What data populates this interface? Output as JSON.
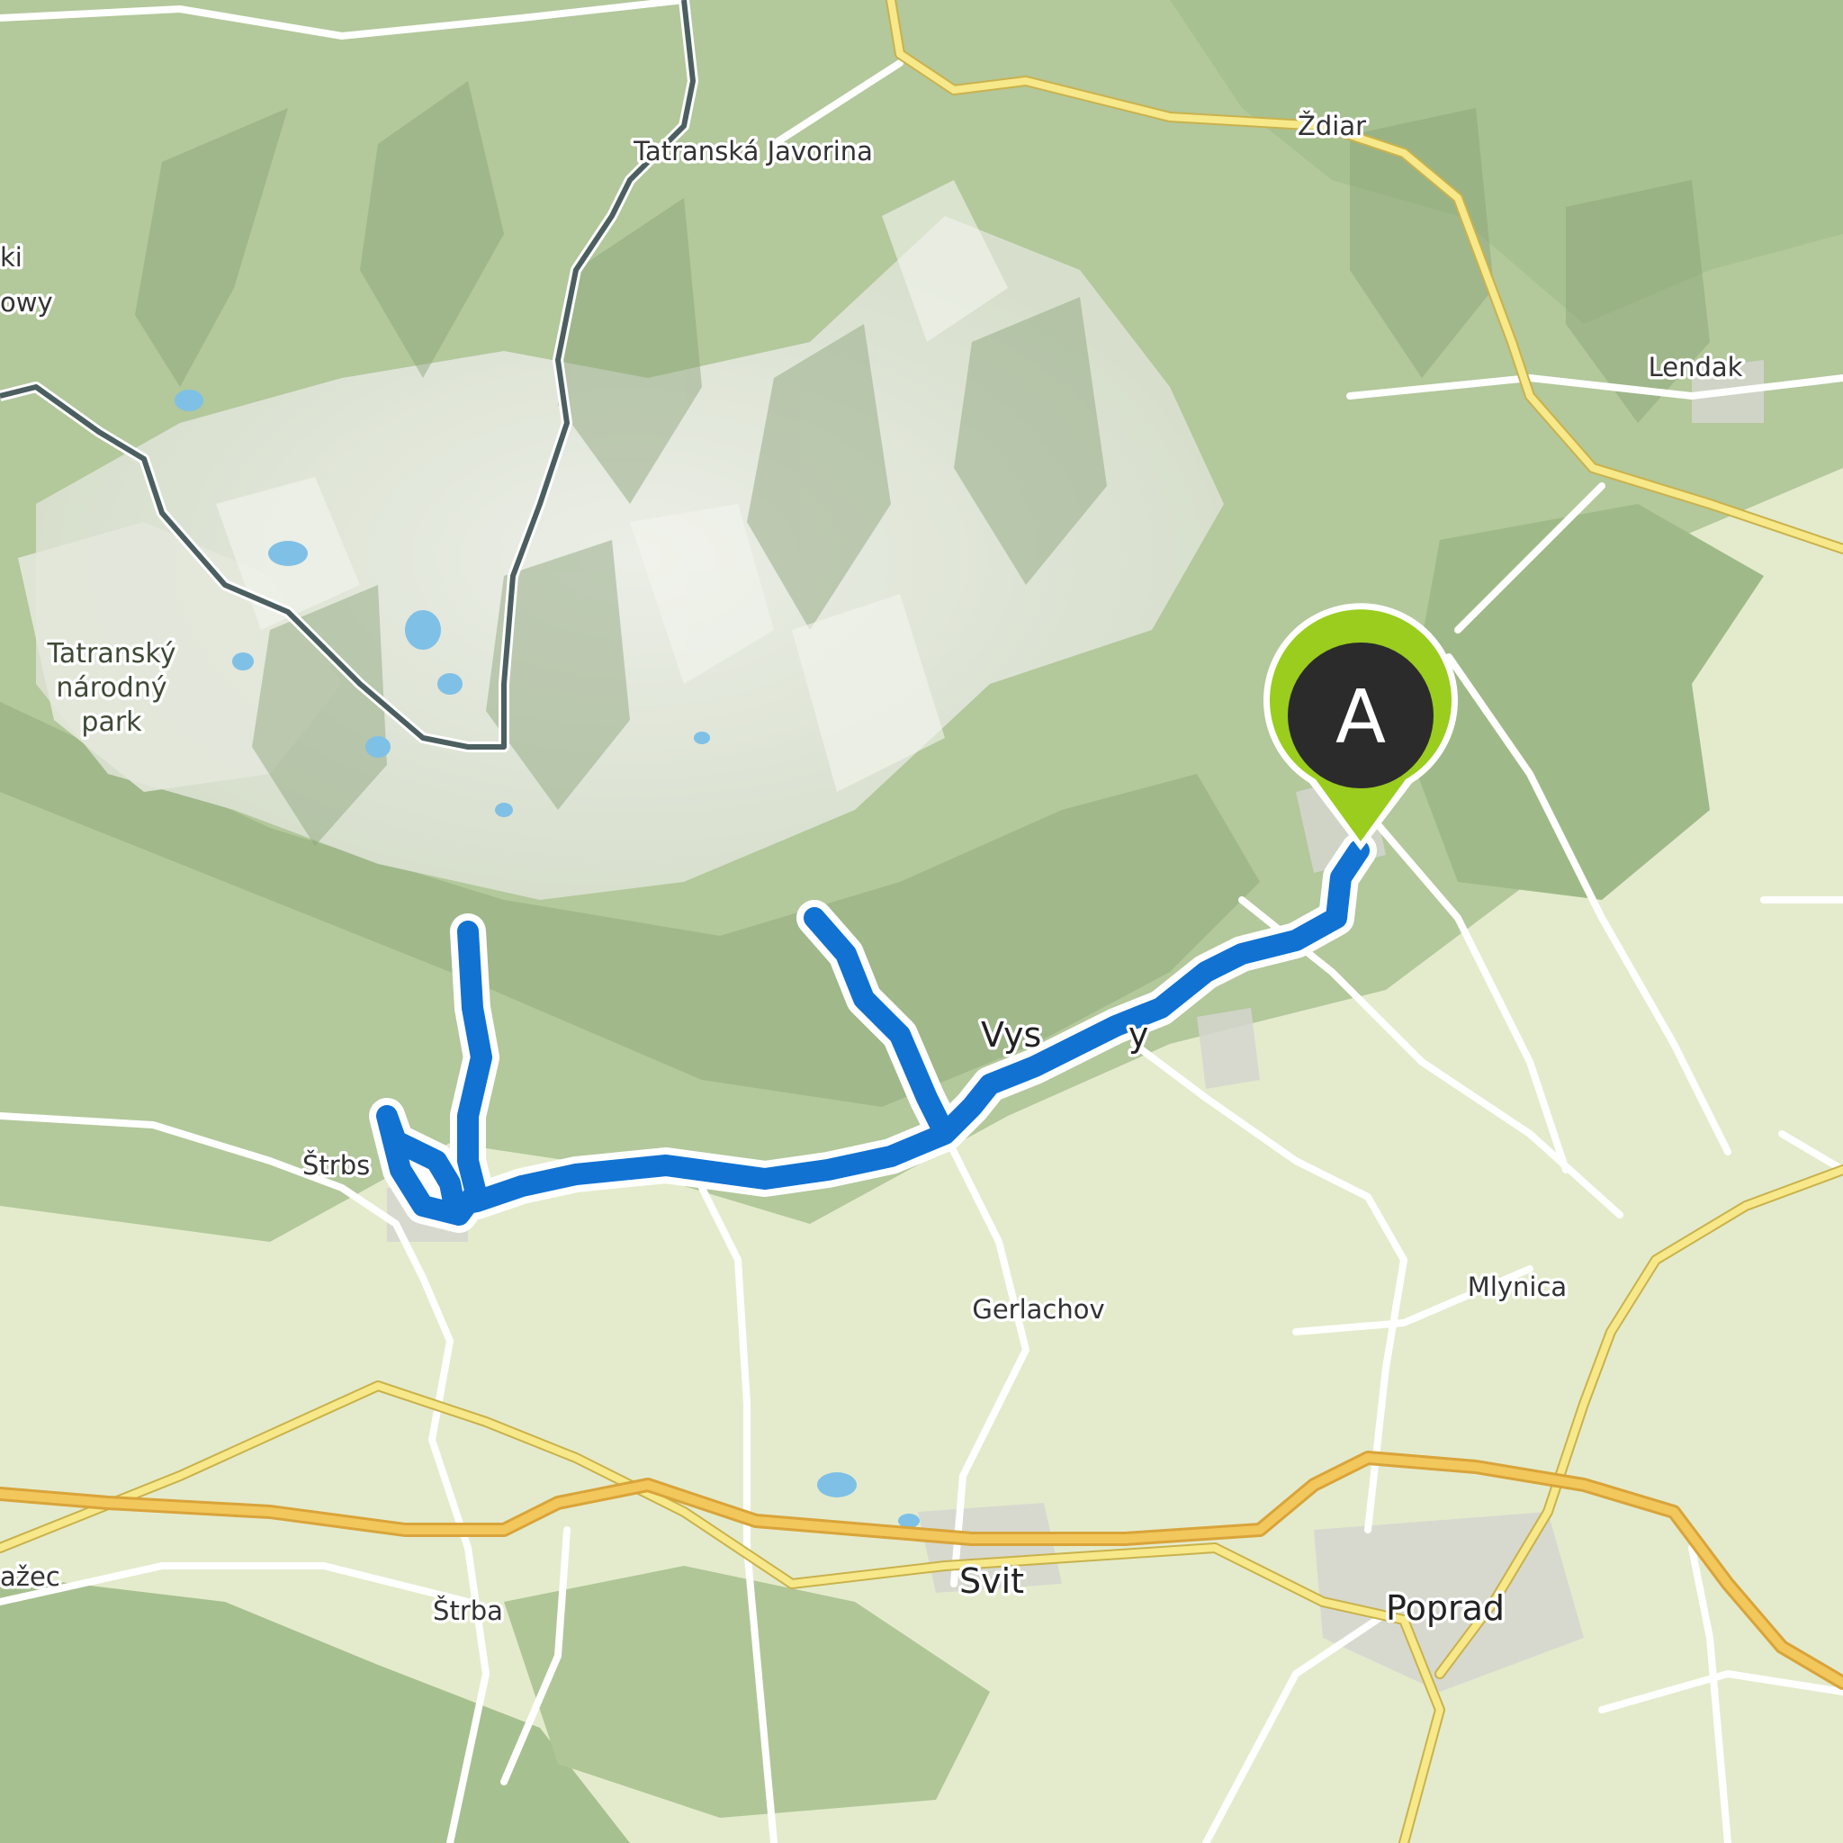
{
  "map": {
    "place_labels": {
      "tatranska_javorina": "Tatranská Javorina",
      "zdiar": "Ždiar",
      "lendak": "Lendak",
      "park_line1": "Tatranský",
      "park_line2": "národný",
      "park_line3": "park",
      "cut_left_1": "ki",
      "cut_left_2": "owy",
      "strbske_cut": "Štrbs",
      "vysoke_tatry_cut": "Vys        y",
      "gerlachov": "Gerlachov",
      "mlynica": "Mlynica",
      "vazec_cut": "ažec",
      "strba": "Štrba",
      "svit": "Svit",
      "poprad": "Poprad"
    },
    "marker": {
      "letter": "A",
      "color": "#9acd1e"
    },
    "colors": {
      "route": "#1172d2",
      "terrain_lowland": "#e7eccf",
      "forest": "#a4bf8e",
      "rock": "#e7ebe3",
      "motorway": "#f2c75b",
      "primary_road": "#f7e88a",
      "border": "#4c5f60",
      "water": "#7fc0e6"
    }
  }
}
